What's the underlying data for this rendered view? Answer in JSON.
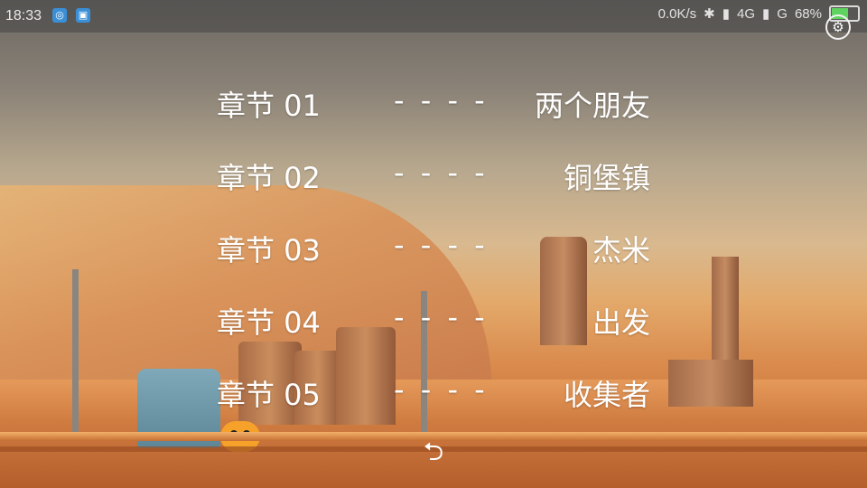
{
  "status_bar": {
    "time": "18:33",
    "network_speed": "0.0K/s",
    "signal_1": "4G",
    "signal_2": "G",
    "battery_percent": "68%",
    "battery_level": 0.68
  },
  "chapters": [
    {
      "label": "章节 01",
      "separator": "- - - -",
      "title": "两个朋友"
    },
    {
      "label": "章节 02",
      "separator": "- - - -",
      "title": "铜堡镇"
    },
    {
      "label": "章节 03",
      "separator": "- - - -",
      "title": "杰米"
    },
    {
      "label": "章节 04",
      "separator": "- - - -",
      "title": "出发"
    },
    {
      "label": "章节 05",
      "separator": "- - - -",
      "title": "收集者"
    }
  ],
  "icons": {
    "settings": "gear-icon",
    "back": "undo-arrow-icon"
  },
  "colors": {
    "text": "#ffffff",
    "status_bar_bg": "#464646"
  }
}
